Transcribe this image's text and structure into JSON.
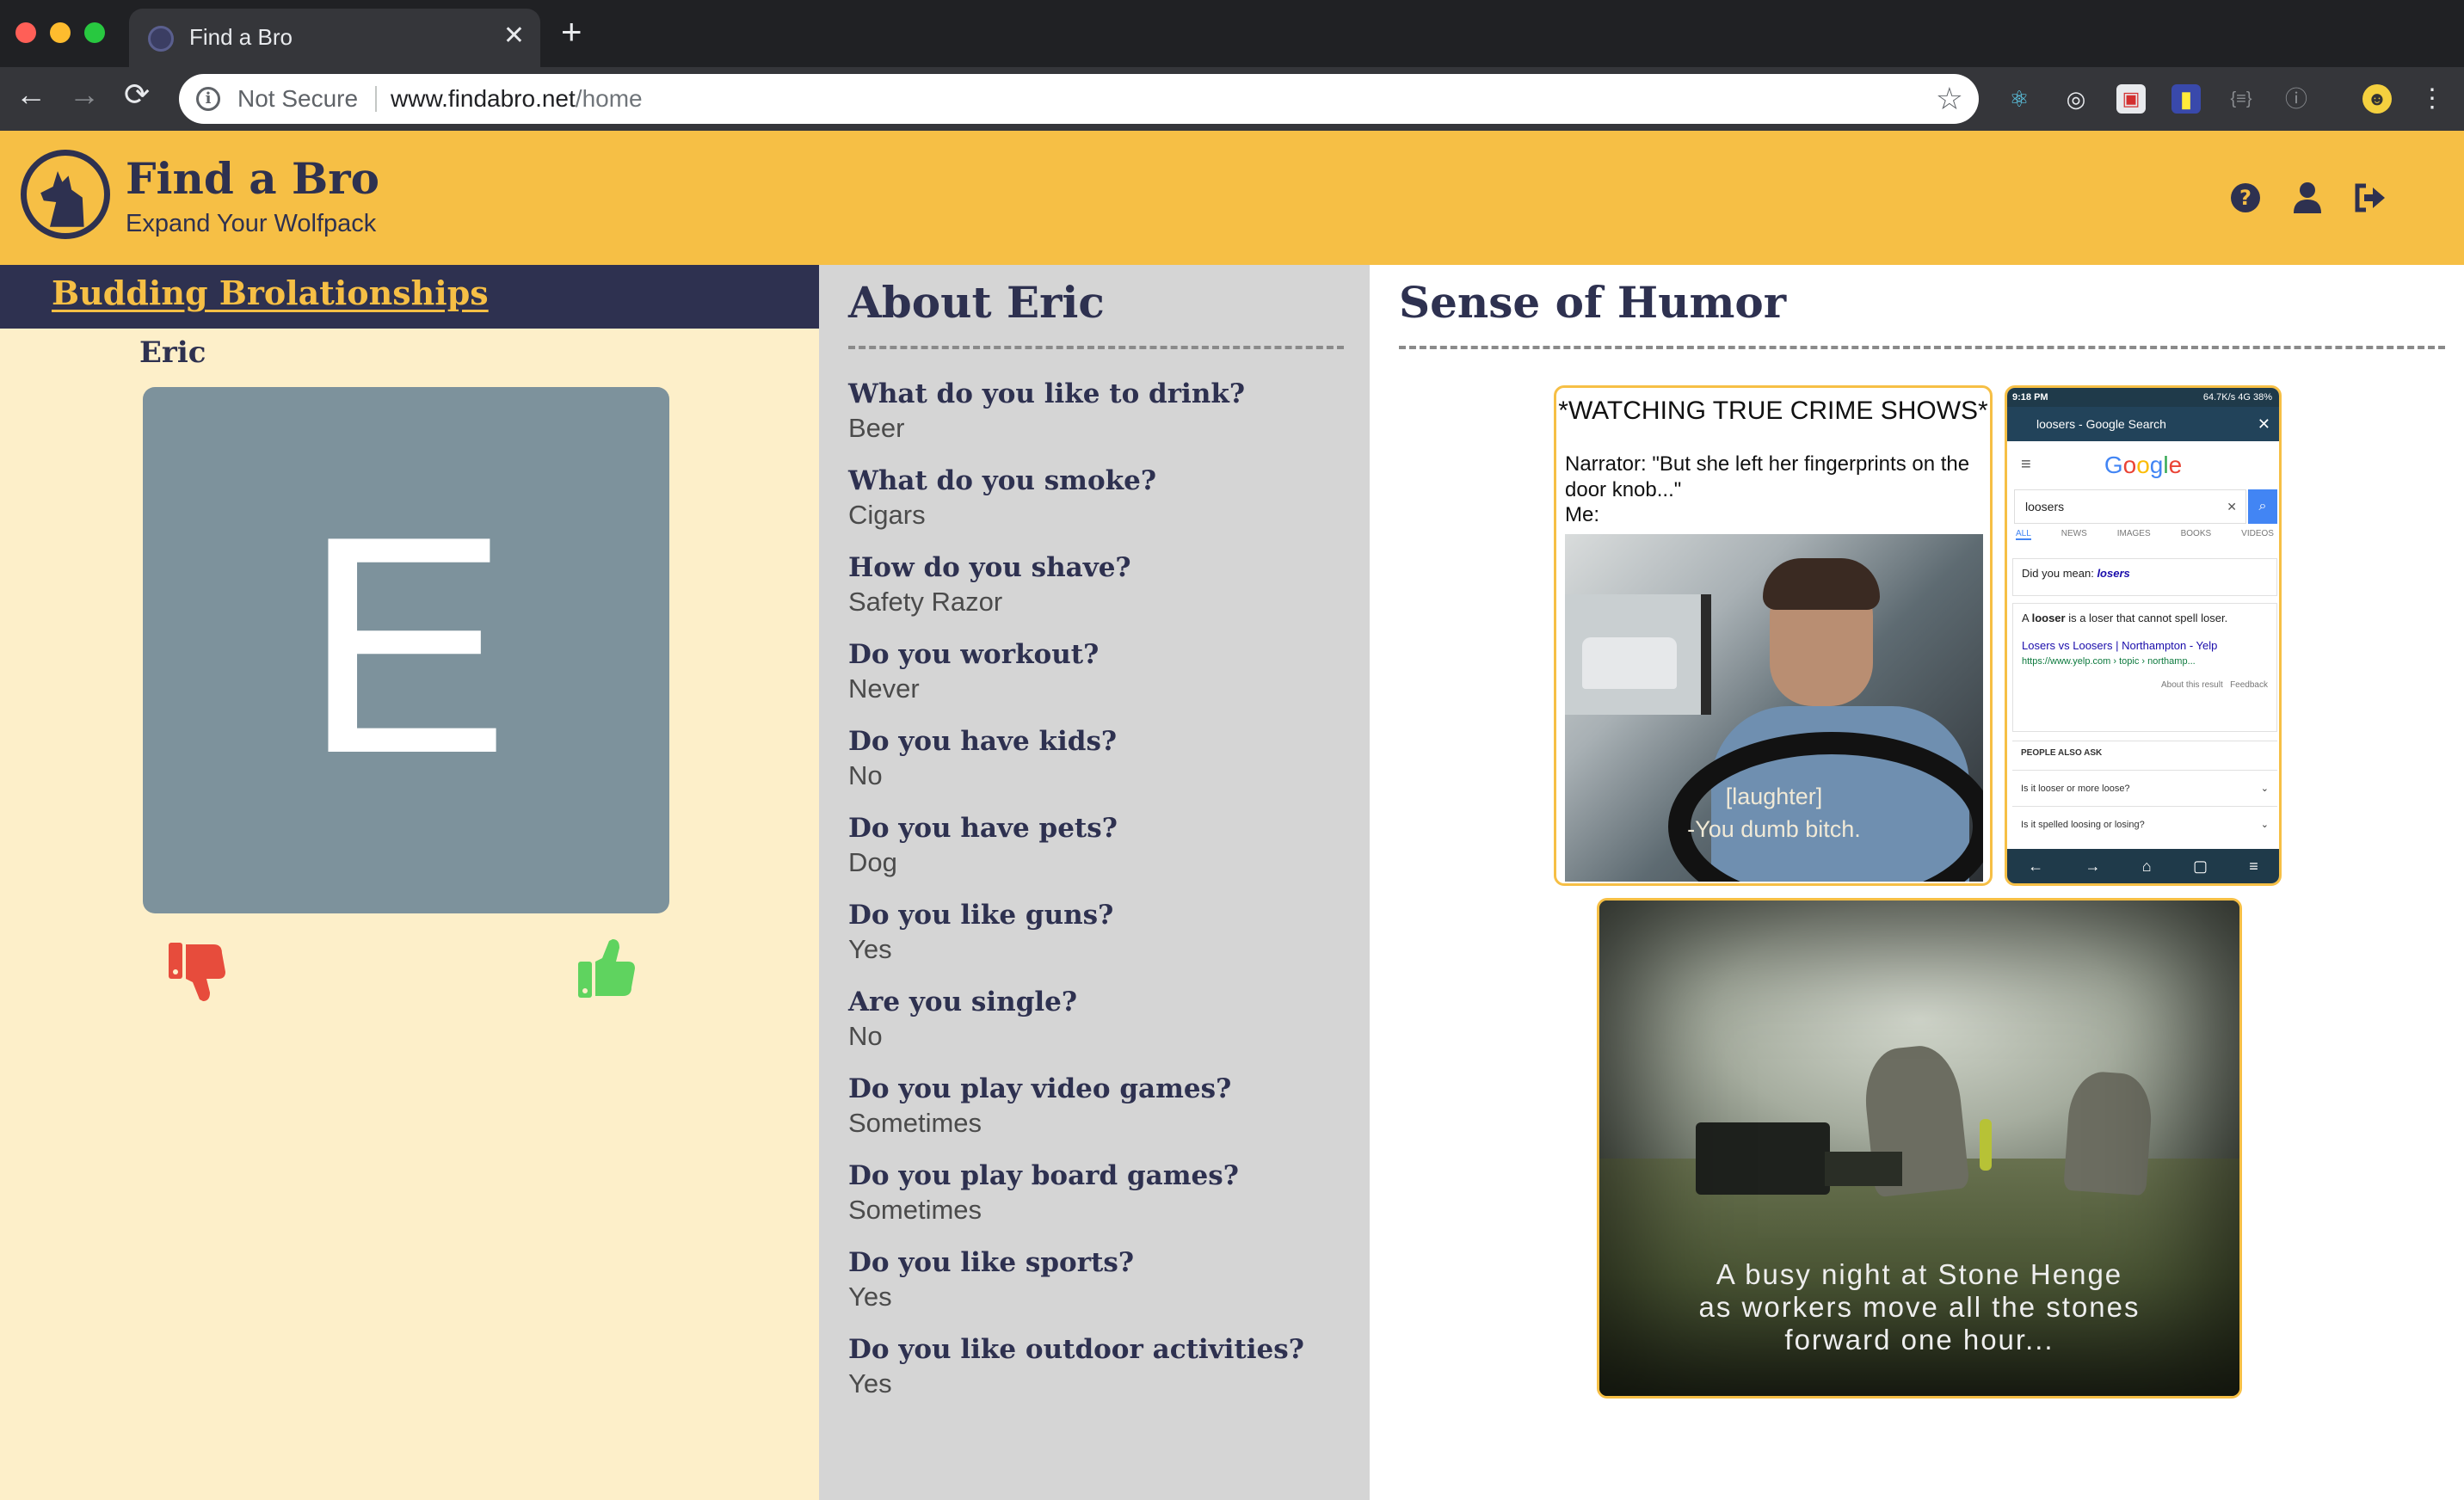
{
  "browser": {
    "tab_title": "Find a Bro",
    "tab_close": "✕",
    "new_tab": "+",
    "security_label": "Not Secure",
    "url_host": "www.findabro.net",
    "url_path": "/home"
  },
  "header": {
    "title": "Find a Bro",
    "subtitle": "Expand Your Wolfpack"
  },
  "brolationships": {
    "heading": "Budding Brolationships",
    "name": "Eric",
    "avatar_initial": "E"
  },
  "about": {
    "title": "About Eric",
    "qa": [
      {
        "q": "What do you like to drink?",
        "a": "Beer"
      },
      {
        "q": "What do you smoke?",
        "a": "Cigars"
      },
      {
        "q": "How do you shave?",
        "a": "Safety Razor"
      },
      {
        "q": "Do you workout?",
        "a": "Never"
      },
      {
        "q": "Do you have kids?",
        "a": "No"
      },
      {
        "q": "Do you have pets?",
        "a": "Dog"
      },
      {
        "q": "Do you like guns?",
        "a": "Yes"
      },
      {
        "q": "Are you single?",
        "a": "No"
      },
      {
        "q": "Do you play video games?",
        "a": "Sometimes"
      },
      {
        "q": "Do you play board games?",
        "a": "Sometimes"
      },
      {
        "q": "Do you like sports?",
        "a": "Yes"
      },
      {
        "q": "Do you like outdoor activities?",
        "a": "Yes"
      }
    ]
  },
  "humor": {
    "title": "Sense of Humor",
    "meme1": {
      "heading": "*WATCHING TRUE CRIME SHOWS*",
      "narrator": "Narrator: \"But she left her fingerprints on the door knob...\"",
      "me": "Me:",
      "sub1": "[laughter]",
      "sub2": "-You dumb bitch."
    },
    "meme2": {
      "status_time": "9:18 PM",
      "status_right": "64.7K/s 4G 38%",
      "title": "loosers - Google Search",
      "google": [
        "G",
        "o",
        "o",
        "g",
        "l",
        "e"
      ],
      "query": "loosers",
      "tabs": [
        "ALL",
        "NEWS",
        "IMAGES",
        "BOOKS",
        "VIDEOS"
      ],
      "did_you_mean_prefix": "Did you mean: ",
      "did_you_mean": "losers",
      "definition_a": "A ",
      "definition_word": "looser",
      "definition_rest": " is a loser that cannot spell loser.",
      "link": "Losers vs Loosers | Northampton - Yelp",
      "link_url": "https://www.yelp.com › topic › northamp...",
      "about_result": "About this result",
      "feedback": "Feedback",
      "people_also_ask": "PEOPLE ALSO ASK",
      "q1": "Is it looser or more loose?",
      "q2": "Is it spelled loosing or losing?"
    },
    "meme3": {
      "line1": "A busy night at Stone Henge",
      "line2": "as workers move all the stones",
      "line3": "forward one hour..."
    }
  },
  "colors": {
    "brand_yellow": "#f6bf45",
    "brand_navy": "#2e3150",
    "dislike_red": "#e74c3c",
    "like_green": "#5fd35f"
  },
  "icons": [
    "info-icon",
    "star-icon",
    "help-icon",
    "user-icon",
    "logout-icon",
    "thumbs-down-icon",
    "thumbs-up-icon",
    "wolf-logo"
  ]
}
